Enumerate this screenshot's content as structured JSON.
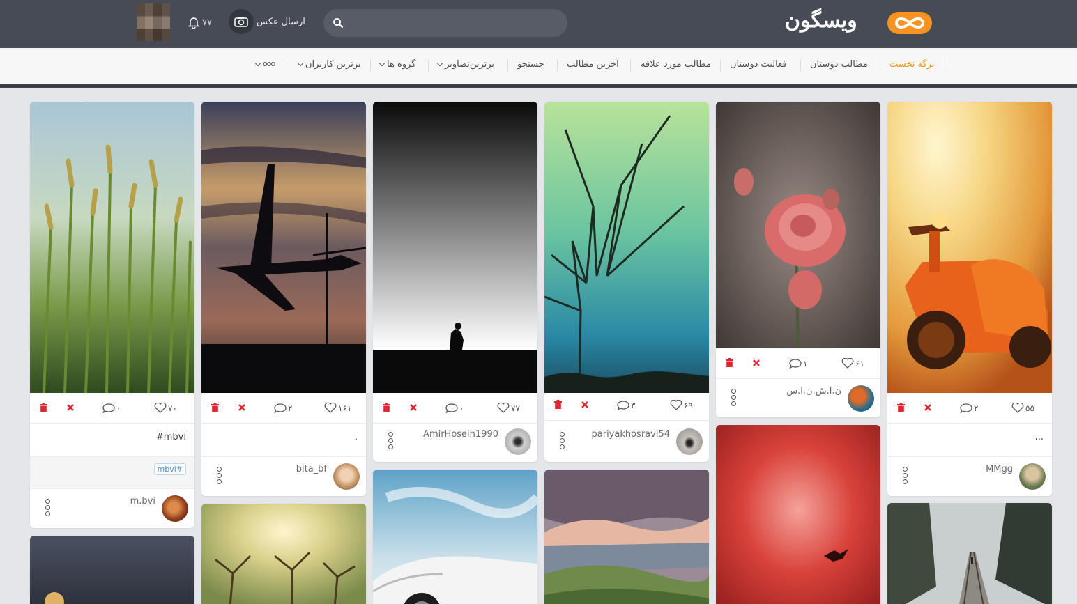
{
  "header": {
    "logo_text": "ویسگون",
    "search_placeholder": "",
    "send_photo_label": "ارسال عکس",
    "notification_count": "۷۷"
  },
  "nav": {
    "items": [
      {
        "label": "برگه نخست",
        "active": true
      },
      {
        "label": "مطالب دوستان"
      },
      {
        "label": "فعالیت دوستان"
      },
      {
        "label": "مطالب مورد علاقه"
      },
      {
        "label": "آخرین مطالب"
      },
      {
        "label": "جستجو"
      },
      {
        "label": "برترین‌تصاویر"
      },
      {
        "label": "گروه ها"
      },
      {
        "label": "برترین کاربران"
      },
      {
        "label": "ooo"
      }
    ]
  },
  "posts": [
    {
      "likes": "۷۰",
      "comments": "۰",
      "caption": "mbvi#",
      "tag": "mbvi#",
      "user": "m.bvi"
    },
    {
      "likes": "۱۶۱",
      "comments": "۲",
      "caption": ".",
      "user": "bita_bf"
    },
    {
      "likes": "۷۷",
      "comments": "۰",
      "user": "AmirHosein1990"
    },
    {
      "likes": "۶۹",
      "comments": "۳",
      "user": "pariyakhosravi54"
    },
    {
      "likes": "۶۱",
      "comments": "۱",
      "user": "ن.ا.ش.ن.ا.س"
    },
    {
      "likes": "۵۵",
      "comments": "۲",
      "caption": "...",
      "user": "MMgg"
    }
  ],
  "colors": {
    "header_bg": "#464b56",
    "accent": "#f7931e",
    "delete_red": "#e0262f",
    "tag_blue": "#4a90c8"
  },
  "icons": {
    "like": "heart-icon",
    "comment": "comment-icon",
    "delete": "trash-icon",
    "remove": "close-icon",
    "more": "more-vertical-icon",
    "search": "search-icon",
    "camera": "camera-icon",
    "notification": "bell-icon"
  }
}
